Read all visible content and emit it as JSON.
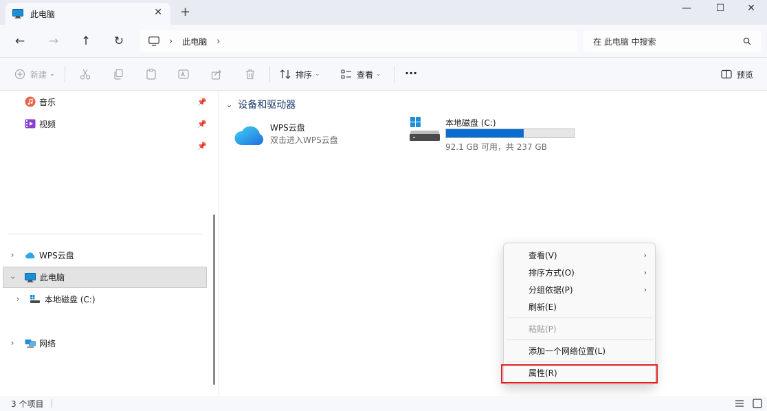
{
  "window": {
    "tab_title": "此电脑",
    "tab_close": "✕",
    "new_tab": "+"
  },
  "window_controls": {
    "minimize": "—",
    "maximize": "☐",
    "close": "✕"
  },
  "nav": {
    "back": "←",
    "forward": "→",
    "up": "↑",
    "refresh": "↻"
  },
  "address": {
    "separator": "›",
    "crumb": "此电脑",
    "trailing": "›"
  },
  "search": {
    "placeholder": "在 此电脑 中搜索"
  },
  "toolbar": {
    "new_label": "新建",
    "sort_label": "排序",
    "view_label": "查看",
    "more_label": "···",
    "preview_label": "预览"
  },
  "sidebar": {
    "quick": [
      {
        "label": "音乐",
        "icon": "music-icon"
      },
      {
        "label": "视频",
        "icon": "video-icon"
      }
    ],
    "tree": [
      {
        "label": "WPS云盘",
        "icon": "cloud-icon"
      },
      {
        "label": "此电脑",
        "icon": "pc-icon",
        "selected": true
      },
      {
        "label": "本地磁盘 (C:)",
        "icon": "drive-icon"
      },
      {
        "label": "网络",
        "icon": "network-icon"
      }
    ]
  },
  "content": {
    "group_title": "设备和驱动器",
    "items": [
      {
        "name": "WPS云盘",
        "sub": "双击进入WPS云盘",
        "icon": "cloud-icon"
      },
      {
        "name": "本地磁盘 (C:)",
        "sub": "92.1 GB 可用，共 237 GB",
        "icon": "drive-icon",
        "used_fraction": 0.61
      }
    ]
  },
  "context_menu": {
    "items": [
      {
        "label": "查看(V)",
        "submenu": true,
        "enabled": true
      },
      {
        "label": "排序方式(O)",
        "submenu": true,
        "enabled": true
      },
      {
        "label": "分组依据(P)",
        "submenu": true,
        "enabled": true
      },
      {
        "label": "刷新(E)",
        "submenu": false,
        "enabled": true
      },
      {
        "label": "粘贴(P)",
        "submenu": false,
        "enabled": false
      },
      {
        "label": "添加一个网络位置(L)",
        "submenu": false,
        "enabled": true
      },
      {
        "label": "属性(R)",
        "submenu": false,
        "enabled": true,
        "highlighted": true
      }
    ],
    "submenu_glyph": "›"
  },
  "status": {
    "count": "3 个项目"
  },
  "colors": {
    "accent": "#0b6cd0",
    "highlight_box": "#e02020",
    "group_title": "#1e3a6e"
  }
}
